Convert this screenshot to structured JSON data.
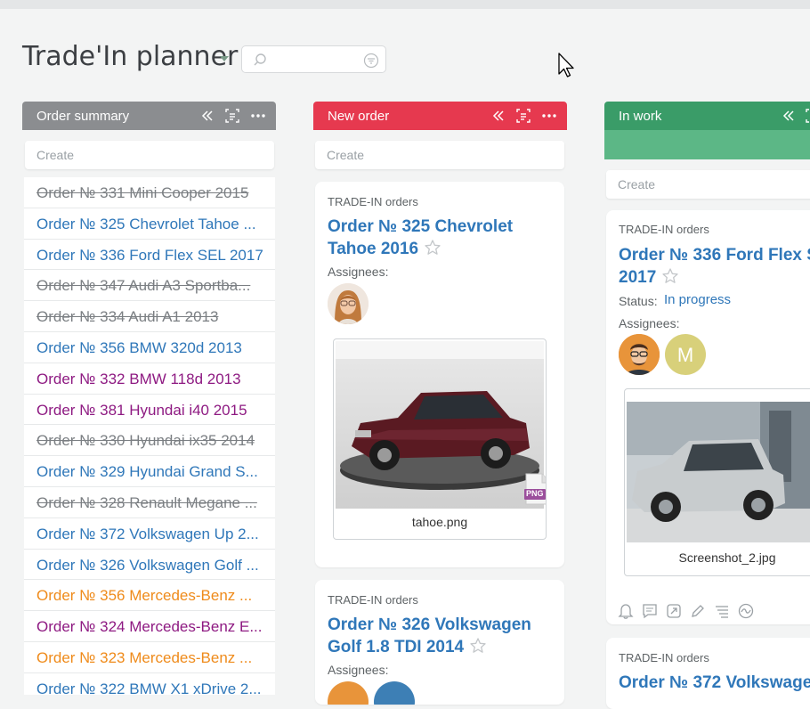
{
  "app": {
    "title": "Trade'In planner"
  },
  "search": {
    "placeholder": ""
  },
  "columns": {
    "order_summary": {
      "label": "Order summary",
      "color": "#8b8d90",
      "create": "Create"
    },
    "new_order": {
      "label": "New order",
      "color": "#e6394f",
      "create": "Create"
    },
    "in_work": {
      "label": "In work",
      "color": "#3a9c68",
      "create": "Create"
    }
  },
  "summary_list": [
    {
      "text": "Order № 331 Mini Cooper 2015",
      "style": "struck"
    },
    {
      "text": "Order № 325 Chevrolet Tahoe ...",
      "style": "blue"
    },
    {
      "text": "Order № 336 Ford Flex SEL 2017",
      "style": "blue"
    },
    {
      "text": "Order № 347 Audi A3 Sportba...",
      "style": "struck"
    },
    {
      "text": "Order № 334 Audi A1 2013",
      "style": "struck"
    },
    {
      "text": "Order № 356 BMW 320d 2013",
      "style": "blue"
    },
    {
      "text": "Order № 332 BMW 118d 2013",
      "style": "purple"
    },
    {
      "text": "Order № 381 Hyundai i40 2015",
      "style": "purple"
    },
    {
      "text": "Order № 330 Hyundai ix35 2014",
      "style": "struck"
    },
    {
      "text": "Order № 329 Hyundai Grand S...",
      "style": "blue"
    },
    {
      "text": "Order № 328 Renault Megane ...",
      "style": "struck"
    },
    {
      "text": "Order № 372 Volkswagen Up 2...",
      "style": "blue"
    },
    {
      "text": "Order № 326 Volkswagen Golf ...",
      "style": "blue"
    },
    {
      "text": "Order № 356 Mercedes-Benz ...",
      "style": "orange"
    },
    {
      "text": "Order № 324 Mercedes-Benz E...",
      "style": "purple"
    },
    {
      "text": "Order № 323 Mercedes-Benz ...",
      "style": "orange"
    },
    {
      "text": "Order № 322 BMW X1 xDrive 2...",
      "style": "blue"
    }
  ],
  "cards": {
    "tahoe": {
      "project": "TRADE-IN orders",
      "title_line1": "Order № 325 Chevrolet",
      "title_line2": "Tahoe 2016",
      "assignees_label": "Assignees:",
      "file": "tahoe.png",
      "file_badge": "PNG"
    },
    "golf": {
      "project": "TRADE-IN orders",
      "title_line1": "Order № 326 Volkswagen",
      "title_line2": "Golf 1.8 TDI 2014",
      "assignees_label": "Assignees:"
    },
    "flex": {
      "project": "TRADE-IN orders",
      "title_line1": "Order № 336 Ford Flex S",
      "title_line2": "2017",
      "status_label": "Status:",
      "status_value": "In progress",
      "assignees_label": "Assignees:",
      "avatar_letter": "M",
      "file": "Screenshot_2.jpg"
    },
    "up": {
      "project": "TRADE-IN orders",
      "title_line1": "Order № 372 Volkswage"
    }
  },
  "colors": {
    "link": "#2f77b9",
    "purple": "#8e1a82",
    "orange": "#ef8b1b"
  }
}
